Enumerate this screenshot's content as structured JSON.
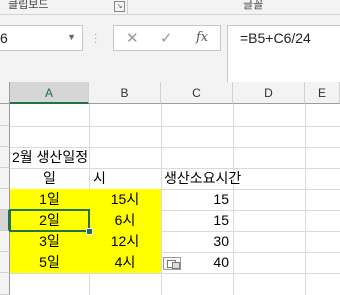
{
  "ribbon": {
    "clipboard_group": "클립보드",
    "font_group": "글꼴",
    "launcher_icon": "dialog-launcher-icon"
  },
  "formula_bar": {
    "name_box_value": "6",
    "formula": "=B5+C6/24",
    "cancel_icon": "✕",
    "enter_icon": "✓",
    "fx_label": "fx"
  },
  "columns": [
    "A",
    "B",
    "C",
    "D",
    "E"
  ],
  "selected_column": "A",
  "sheet": {
    "title": "2월 생산일정",
    "headers": {
      "day": "일",
      "hour": "시",
      "duration": "생산소요시간"
    },
    "rows": [
      {
        "day": "1일",
        "hour": "15시",
        "duration": "15"
      },
      {
        "day": "2일",
        "hour": "6시",
        "duration": "15"
      },
      {
        "day": "3일",
        "hour": "12시",
        "duration": "30"
      },
      {
        "day": "5일",
        "hour": "4시",
        "duration": "40"
      }
    ]
  },
  "colors": {
    "highlight": "#ffff00",
    "selection": "#217346"
  }
}
